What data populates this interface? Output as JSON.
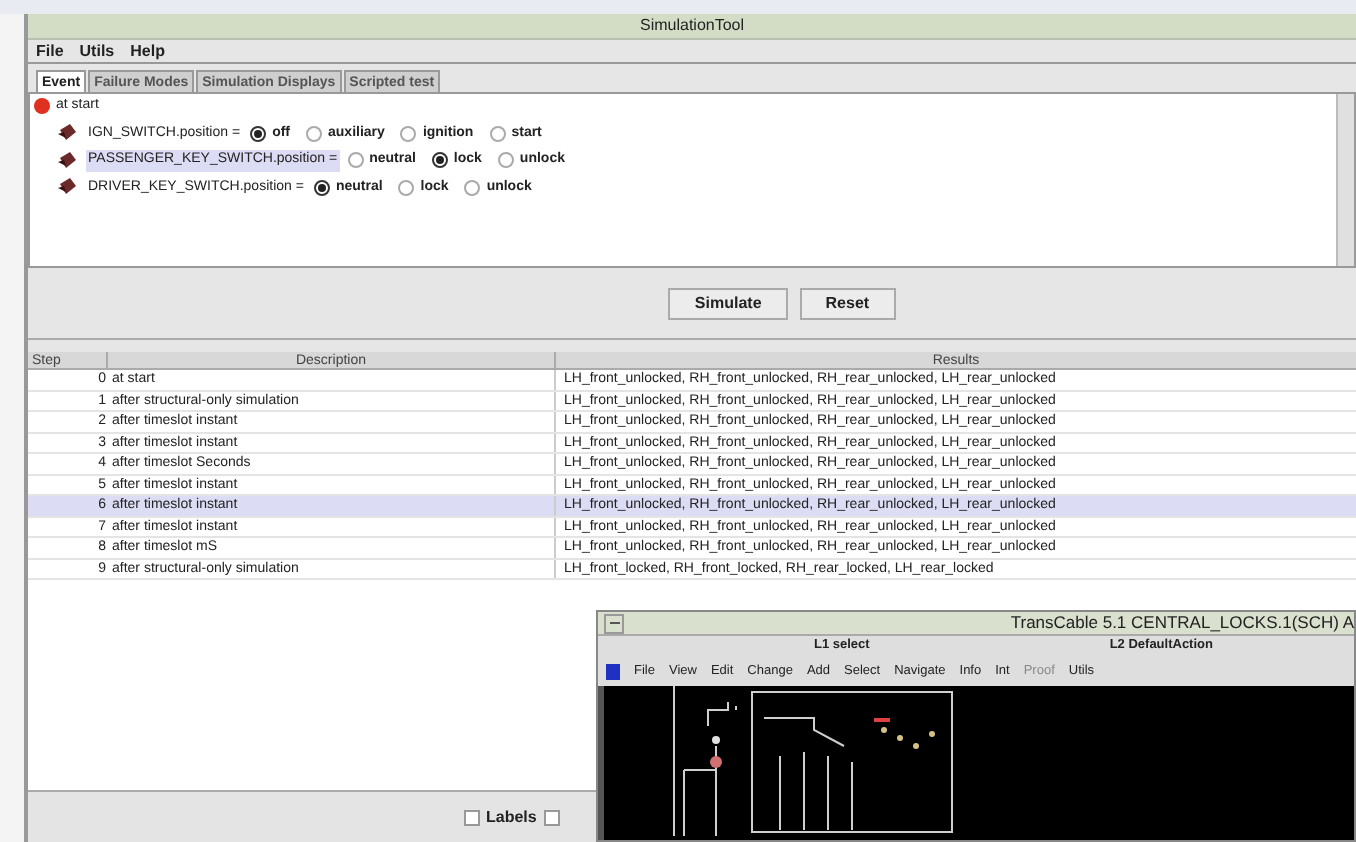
{
  "window": {
    "title": "SimulationTool"
  },
  "menu": [
    "File",
    "Utils",
    "Help"
  ],
  "tabs": [
    {
      "label": "Event",
      "selected": true
    },
    {
      "label": "Failure Modes",
      "selected": false
    },
    {
      "label": "Simulation Displays",
      "selected": false
    },
    {
      "label": "Scripted test",
      "selected": false
    }
  ],
  "event": {
    "root": "at start",
    "switches": [
      {
        "name": "IGN_SWITCH.position =",
        "highlighted": false,
        "options": [
          {
            "label": "off",
            "selected": true
          },
          {
            "label": "auxiliary",
            "selected": false
          },
          {
            "label": "ignition",
            "selected": false
          },
          {
            "label": "start",
            "selected": false
          }
        ]
      },
      {
        "name": "PASSENGER_KEY_SWITCH.position =",
        "highlighted": true,
        "options": [
          {
            "label": "neutral",
            "selected": false
          },
          {
            "label": "lock",
            "selected": true
          },
          {
            "label": "unlock",
            "selected": false
          }
        ]
      },
      {
        "name": "DRIVER_KEY_SWITCH.position =",
        "highlighted": false,
        "options": [
          {
            "label": "neutral",
            "selected": true
          },
          {
            "label": "lock",
            "selected": false
          },
          {
            "label": "unlock",
            "selected": false
          }
        ]
      }
    ]
  },
  "buttons": [
    "Simulate",
    "Reset"
  ],
  "table": {
    "columns": [
      "Step",
      "Description",
      "Results"
    ],
    "rows": [
      {
        "step": "0",
        "description": "at start",
        "results": "LH_front_unlocked, RH_front_unlocked, RH_rear_unlocked, LH_rear_unlocked",
        "selected": false
      },
      {
        "step": "1",
        "description": "after structural-only simulation",
        "results": "LH_front_unlocked, RH_front_unlocked, RH_rear_unlocked, LH_rear_unlocked",
        "selected": false
      },
      {
        "step": "2",
        "description": "after timeslot instant",
        "results": "LH_front_unlocked, RH_front_unlocked, RH_rear_unlocked, LH_rear_unlocked",
        "selected": false
      },
      {
        "step": "3",
        "description": "after timeslot instant",
        "results": "LH_front_unlocked, RH_front_unlocked, RH_rear_unlocked, LH_rear_unlocked",
        "selected": false
      },
      {
        "step": "4",
        "description": "after timeslot Seconds",
        "results": "LH_front_unlocked, RH_front_unlocked, RH_rear_unlocked, LH_rear_unlocked",
        "selected": false
      },
      {
        "step": "5",
        "description": "after timeslot instant",
        "results": "LH_front_unlocked, RH_front_unlocked, RH_rear_unlocked, LH_rear_unlocked",
        "selected": false
      },
      {
        "step": "6",
        "description": "after timeslot instant",
        "results": "LH_front_unlocked, RH_front_unlocked, RH_rear_unlocked, LH_rear_unlocked",
        "selected": true
      },
      {
        "step": "7",
        "description": "after timeslot instant",
        "results": "LH_front_unlocked, RH_front_unlocked, RH_rear_unlocked, LH_rear_unlocked",
        "selected": false
      },
      {
        "step": "8",
        "description": "after timeslot mS",
        "results": "LH_front_unlocked, RH_front_unlocked, RH_rear_unlocked, LH_rear_unlocked",
        "selected": false
      },
      {
        "step": "9",
        "description": "after structural-only simulation",
        "results": "LH_front_locked, RH_front_locked, RH_rear_locked, LH_rear_locked",
        "selected": false
      }
    ]
  },
  "options": [
    {
      "label": "Labels",
      "checked": false
    },
    {
      "checked": false
    }
  ],
  "second_window": {
    "title": "TransCable 5.1 CENTRAL_LOCKS.1(SCH) A",
    "status": [
      "L1 select",
      "L2 DefaultAction"
    ],
    "menu": [
      {
        "label": "File",
        "disabled": false
      },
      {
        "label": "View",
        "disabled": false
      },
      {
        "label": "Edit",
        "disabled": false
      },
      {
        "label": "Change",
        "disabled": false
      },
      {
        "label": "Add",
        "disabled": false
      },
      {
        "label": "Select",
        "disabled": false
      },
      {
        "label": "Navigate",
        "disabled": false
      },
      {
        "label": "Info",
        "disabled": false
      },
      {
        "label": "Int",
        "disabled": false
      },
      {
        "label": "Proof",
        "disabled": true
      },
      {
        "label": "Utils",
        "disabled": false
      }
    ]
  }
}
